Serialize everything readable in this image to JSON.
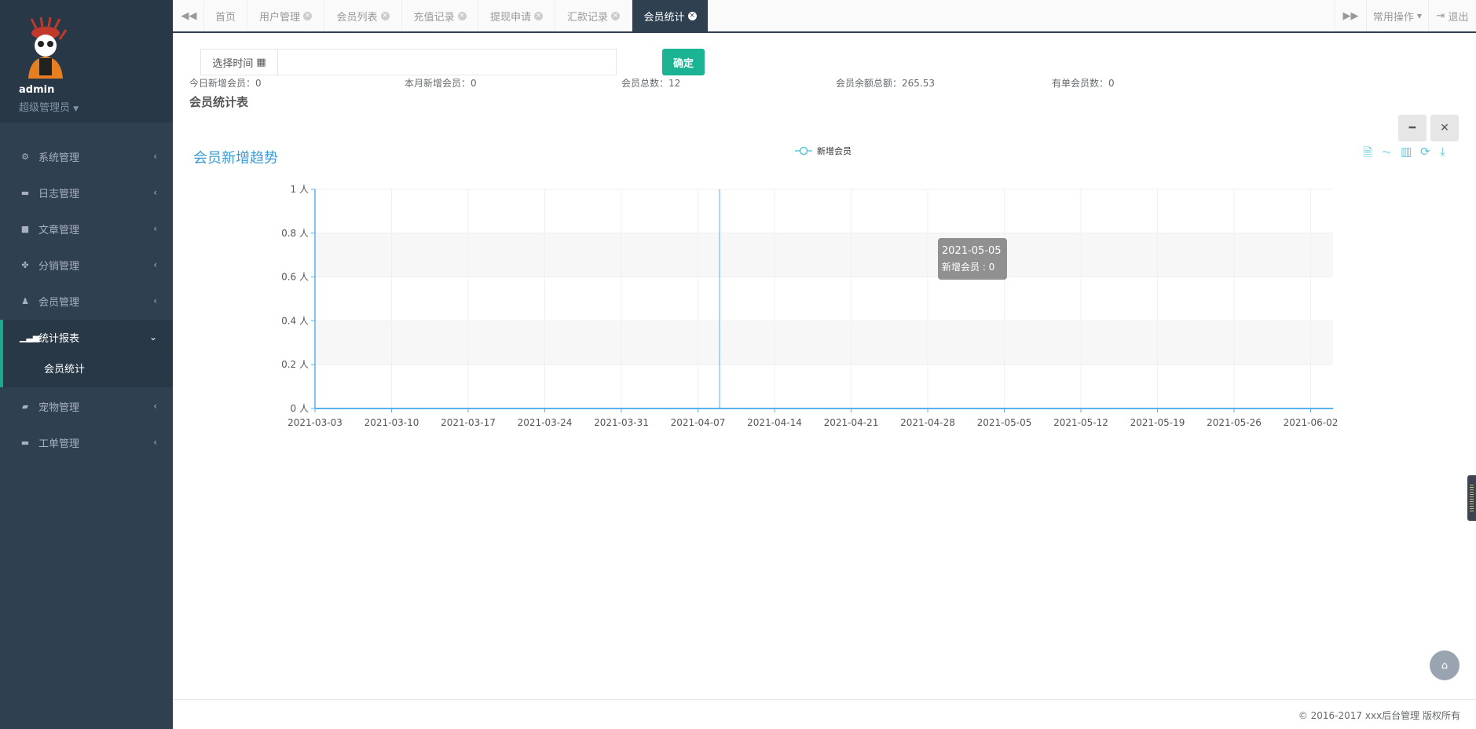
{
  "user": {
    "name": "admin",
    "role": "超级管理员"
  },
  "sidebar": {
    "items": [
      {
        "label": "系统管理",
        "icon": "gear-icon"
      },
      {
        "label": "日志管理",
        "icon": "list-icon"
      },
      {
        "label": "文章管理",
        "icon": "book-icon"
      },
      {
        "label": "分销管理",
        "icon": "cubes-icon"
      },
      {
        "label": "会员管理",
        "icon": "user-icon"
      },
      {
        "label": "统计报表",
        "icon": "signal-icon",
        "sub": [
          "会员统计"
        ]
      },
      {
        "label": "宠物管理",
        "icon": "book-icon"
      },
      {
        "label": "工单管理",
        "icon": "list-icon"
      }
    ]
  },
  "tabs": [
    "首页",
    "用户管理",
    "会员列表",
    "充值记录",
    "提现申请",
    "汇款记录",
    "会员统计"
  ],
  "topbar": {
    "ops": "常用操作",
    "logout": "退出"
  },
  "filter": {
    "label": "选择时间",
    "value": "",
    "confirm": "确定"
  },
  "stats": [
    {
      "label": "今日新增会员：",
      "value": "0"
    },
    {
      "label": "本月新增会员：",
      "value": "0"
    },
    {
      "label": "会员总数：",
      "value": "12"
    },
    {
      "label": "会员余额总额：",
      "value": "265.53"
    },
    {
      "label": "有单会员数：",
      "value": "0"
    }
  ],
  "section_title": "会员统计表",
  "chart_data": {
    "type": "line",
    "title": "会员新增趋势",
    "legend": [
      "新增会员"
    ],
    "categories": [
      "2021-03-03",
      "2021-03-10",
      "2021-03-17",
      "2021-03-24",
      "2021-03-31",
      "2021-04-07",
      "2021-04-14",
      "2021-04-21",
      "2021-04-28",
      "2021-05-05",
      "2021-05-12",
      "2021-05-19",
      "2021-05-26",
      "2021-06-02"
    ],
    "series": [
      {
        "name": "新增会员",
        "values": [
          0,
          0,
          0,
          0,
          0,
          0,
          0,
          0,
          0,
          0,
          0,
          0,
          0,
          0
        ]
      }
    ],
    "yticks": [
      "0 人",
      "0.2 人",
      "0.4 人",
      "0.6 人",
      "0.8 人",
      "1 人"
    ],
    "ylim": [
      0,
      1
    ],
    "tooltip": {
      "date": "2021-05-05",
      "text": "新增会员 : 0"
    },
    "color": "#5ab1ef"
  },
  "footer": "© 2016-2017 xxx后台管理 版权所有"
}
